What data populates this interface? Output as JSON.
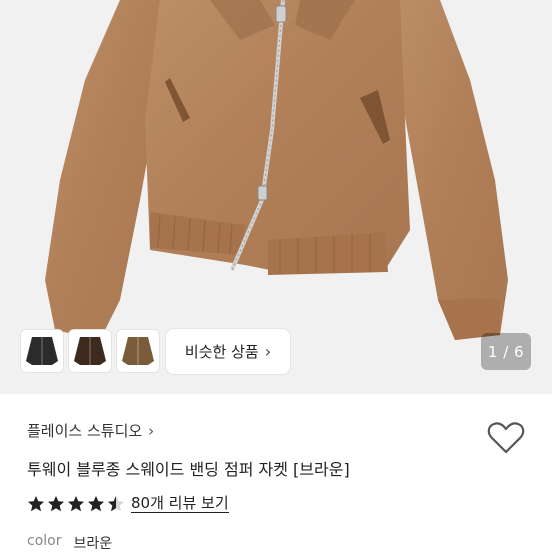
{
  "product": {
    "store_name": "플레이스 스튜디오",
    "title": "투웨이 블루종 스웨이드 밴딩 점퍼 자켓 [브라운]",
    "rating": 4.5,
    "reviews_link": "80개 리뷰 보기",
    "option_label": "color",
    "option_value": "브라운"
  },
  "gallery": {
    "page_counter": "1 / 6",
    "similar_button": "비슷한 상품",
    "thumbnails": [
      "black-jacket",
      "dark-brown-jacket",
      "khaki-jacket"
    ]
  },
  "colors": {
    "jacket": "#b3835d",
    "background": "#f1f1f1",
    "star": "#222222"
  },
  "icons": {
    "store_chevron": "chevron-right-icon",
    "similar_chevron": "chevron-right-icon",
    "wishlist": "heart-outline-icon",
    "rating": "star-icon"
  }
}
